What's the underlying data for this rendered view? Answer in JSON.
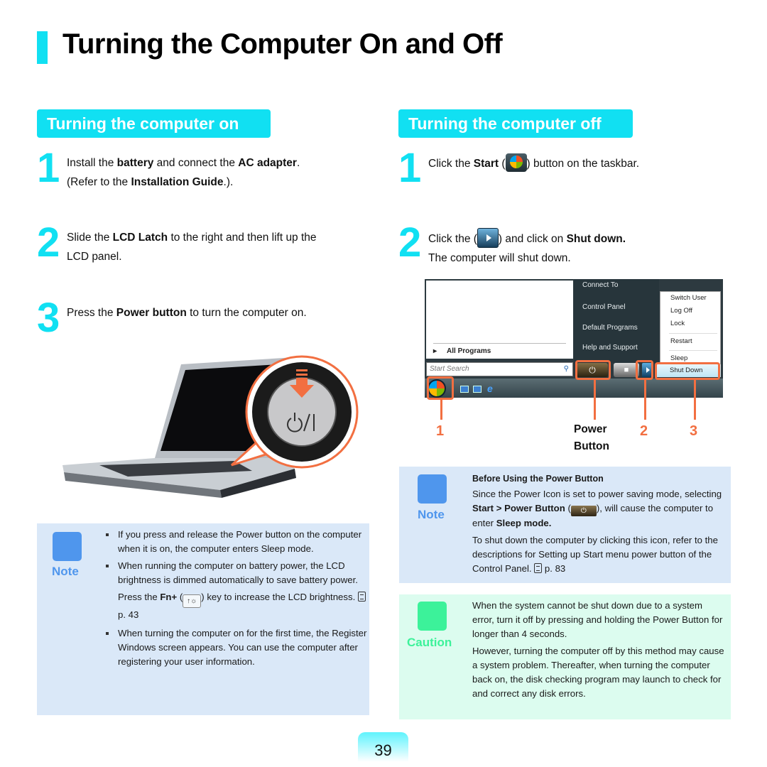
{
  "page_title": "Turning the Computer On and Off",
  "sections": {
    "on": {
      "heading": "Turning the computer on",
      "steps": [
        {
          "num": "1",
          "line1": [
            "Install the ",
            "battery",
            " and connect the ",
            "AC adapter",
            "."
          ],
          "line2": [
            "(Refer to the ",
            "Installation Guide",
            ".)."
          ]
        },
        {
          "num": "2",
          "line1": [
            "Slide the ",
            "LCD Latch",
            " to the right and then lift up the"
          ],
          "line2": [
            "LCD panel."
          ]
        },
        {
          "num": "3",
          "line1": [
            "Press the ",
            "Power button",
            " to turn the computer on."
          ]
        }
      ],
      "illustration": "laptop with power button close-up",
      "note": {
        "tag": "Note",
        "bullets": [
          "If you press and release the Power button on the computer when it is on, the computer enters Sleep mode.",
          "When running the computer on battery power, the LCD brightness is dimmed automatically to save battery power."
        ],
        "fn_text_pre": "Press the ",
        "fn_key": "Fn+",
        "fn_text_post": " key to increase the LCD brightness. ",
        "fn_ref": "p. 43",
        "bullet3": "When turning the computer on for the first time, the Register Windows screen appears. You can use the computer after registering your user information."
      }
    },
    "off": {
      "heading": "Turning the computer off",
      "step1": {
        "num": "1",
        "pre": "Click the ",
        "bold": "Start",
        "post": " button on the taskbar."
      },
      "step2": {
        "num": "2",
        "pre": "Click the ",
        "mid": " and click on ",
        "bold": "Shut down.",
        "line2": "The computer will shut down."
      },
      "screenshot": {
        "all_programs": "All Programs",
        "search_placeholder": "Start Search",
        "right_pane": [
          "Connect To",
          "Control Panel",
          "Default Programs",
          "Help and Support"
        ],
        "submenu": [
          "Switch User",
          "Log Off",
          "Lock",
          "Restart",
          "Sleep"
        ],
        "shutdown": "Shut Down"
      },
      "callouts": {
        "n1": "1",
        "power_label_1": "Power",
        "power_label_2": "Button",
        "n2": "2",
        "n3": "3"
      },
      "note": {
        "tag": "Note",
        "title": "Before Using the Power Button",
        "p1_pre": "Since the Power Icon is set to power saving mode, selecting ",
        "p1_bold": "Start > Power Button",
        "p1_post": ", will cause the computer to enter ",
        "p1_bold2": "Sleep mode.",
        "p2": "To shut down the computer by clicking this icon, refer to the descriptions for Setting up Start menu power button of the Control Panel. ",
        "p2_ref": "p. 83"
      },
      "caution": {
        "tag": "Caution",
        "p1": "When the system cannot be shut down due to a system error, turn it off by pressing and holding the Power Button for longer than 4 seconds.",
        "p2": "However, turning the computer off by this method may cause a system problem. Thereafter, when turning the computer back on, the disk checking program may launch to check for and correct any disk errors."
      }
    }
  },
  "page_number": "39",
  "colors": {
    "accent": "#11e0f2",
    "note": "#4f96ed",
    "caution": "#3cf29a",
    "callout": "#f26f41"
  }
}
